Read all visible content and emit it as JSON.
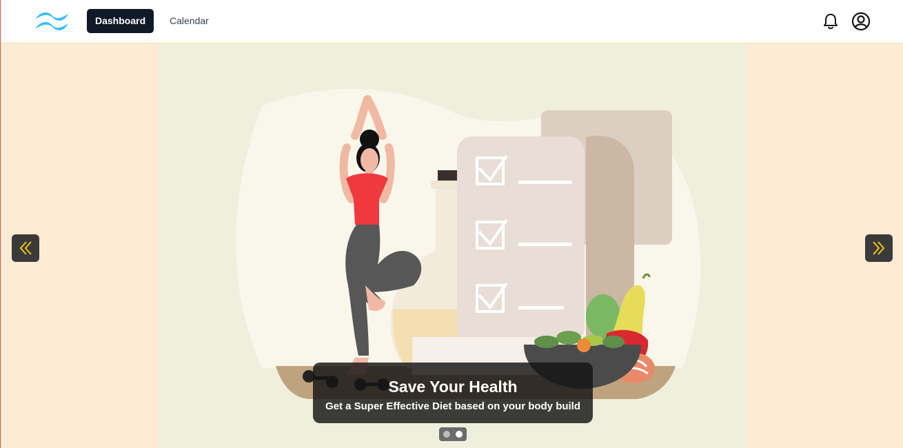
{
  "nav": {
    "logo_icon": "tailwind-wave-logo",
    "items": [
      {
        "label": "Dashboard",
        "active": true
      },
      {
        "label": "Calendar",
        "active": false
      }
    ],
    "icons": [
      "bell-icon",
      "user-circle-icon"
    ]
  },
  "carousel": {
    "slide": {
      "title": "Save Your Health",
      "subtitle": "Get a Super Effective Diet based on your body build"
    },
    "prev_icon": "double-chevron-left-icon",
    "next_icon": "double-chevron-right-icon",
    "indicator_count": 2,
    "active_index": 1
  },
  "colors": {
    "accent": "#38bdf8",
    "nav_active_bg": "#111827",
    "page_bg": "#fdebd5",
    "stage_bg": "#eef0dd",
    "arrow_icon": "#f5c518"
  }
}
